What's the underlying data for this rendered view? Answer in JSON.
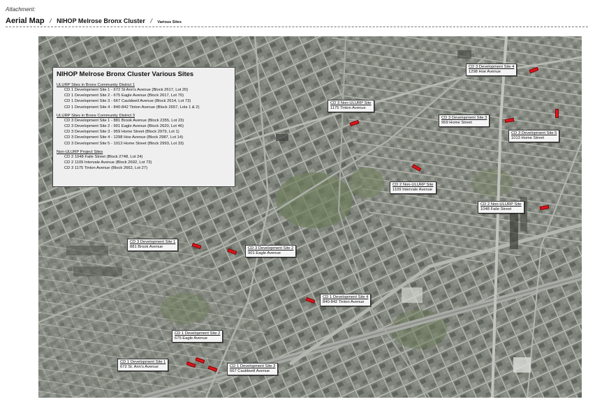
{
  "header": {
    "attachment": "Attachment:",
    "title": "Aerial Map",
    "separator": "/",
    "subtitle": "NIHOP Melrose Bronx Cluster",
    "subtitle_small": "Various Sites"
  },
  "legend": {
    "title": "NIHOP Melrose Bronx Cluster Various Sites",
    "sections": [
      {
        "heading": "ULURP Sites in Bronx Community District 1",
        "items": [
          "CD 1 Development Site 1 - 672 St Ann's Avenue (Block 2617, Lot 20)",
          "CD 1 Development Site 2 - 675 Eagle Avenue (Block 2617, Lot 70)",
          "CD 1 Development Site 3 - 667 Cauldwell Avenue (Block 2614, Lot 73)",
          "CD 1 Development Site 4 - 840-842 Tinton Avenue (Block 2657, Lots 1 & 2)"
        ]
      },
      {
        "heading": "ULURP Sites in Bronx Community District 3",
        "items": [
          "CD 3 Development Site 1 - 881 Brook Avenue (Block 2355, Lot 23)",
          "CD 3 Development Site 2 - 901 Eagle Avenue (Block 2620, Lot 46)",
          "CD 3 Development Site 3 - 959 Home Street (Block 2979, Lot 1)",
          "CD 3 Development Site 4 - 1298 Hoe Avenue (Block 2987, Lot 14)",
          "CD 3 Development Site 5 - 1013 Home Street (Block 2993, Lot 33)"
        ]
      },
      {
        "heading": "Non-ULURP Project Sites",
        "items": [
          "CD 2 1048 Faile Street (Block 2748, Lot 24)",
          "CD 2 1109 Intervale Avenue (Block 2692, Lot 73)",
          "CD 3 1175 Tinton Avenue (Block 2662, Lot 27)"
        ]
      }
    ]
  },
  "site_labels": [
    {
      "title": "CD 3 Development Site 4",
      "address": "1298 Hoe Avenue"
    },
    {
      "title": "CD 3 Non-ULURP Site",
      "address": "1175 Tinton Avenue"
    },
    {
      "title": "CD 3 Development Site 3",
      "address": "959 Home Street"
    },
    {
      "title": "CD 3 Development Site 5",
      "address": "1013 Home Street"
    },
    {
      "title": "CD 2 Non-ULURP Site",
      "address": "1109 Intervale Avenue"
    },
    {
      "title": "CD 2 Non-ULURP Site",
      "address": "1048 Faile Street"
    },
    {
      "title": "CD 3 Development Site 1",
      "address": "881 Brook Avenue"
    },
    {
      "title": "CD 3 Development Site 2",
      "address": "901 Eagle Avenue"
    },
    {
      "title": "CD 1 Development Site 4",
      "address": "840-842 Tinton Avenue"
    },
    {
      "title": "CD 1 Development Site 2",
      "address": "675 Eagle Avenue"
    },
    {
      "title": "CD 1 Development Site 1",
      "address": "672 St. Ann's Avenue"
    },
    {
      "title": "CD 1 Development Site 3",
      "address": "667 Cauldwell Avenue"
    }
  ],
  "colors": {
    "site_marker": "#e1141b",
    "legend_background": "#efefef"
  }
}
